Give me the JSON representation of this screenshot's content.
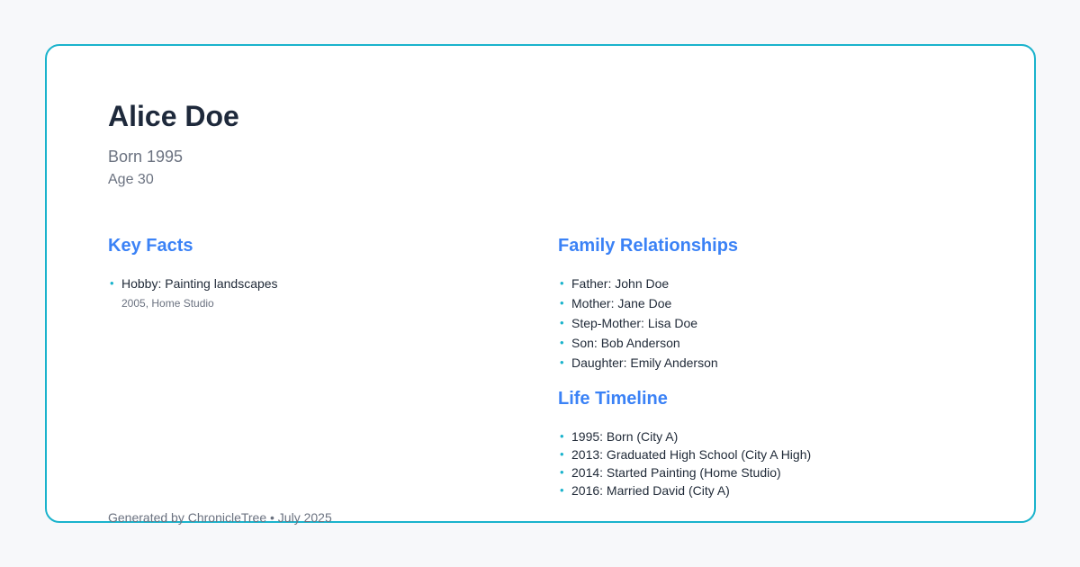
{
  "person": {
    "name": "Alice Doe",
    "born": "Born 1995",
    "age": "Age 30"
  },
  "key_facts": {
    "title": "Key Facts",
    "items": [
      {
        "label": "Hobby: Painting landscapes",
        "detail": "2005, Home Studio"
      }
    ]
  },
  "family": {
    "title": "Family Relationships",
    "items": [
      "Father: John Doe",
      "Mother: Jane Doe",
      "Step-Mother: Lisa Doe",
      "Son: Bob Anderson",
      "Daughter: Emily Anderson"
    ]
  },
  "timeline": {
    "title": "Life Timeline",
    "items": [
      "1995: Born (City A)",
      "2013: Graduated High School (City A High)",
      "2014: Started Painting (Home Studio)",
      "2016: Married David (City A)"
    ]
  },
  "footer": "Generated by ChronicleTree • July 2025",
  "colors": {
    "accent": "#1ab3cc",
    "heading": "#3b82f6",
    "name": "#1e293b",
    "muted": "#6b7280"
  }
}
